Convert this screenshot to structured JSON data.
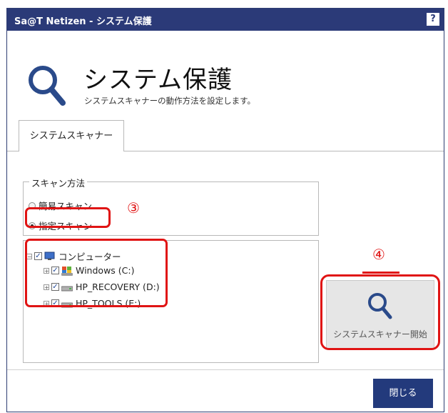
{
  "window": {
    "title": "Sa@T Netizen - システム保護",
    "help_label": "?"
  },
  "header": {
    "title": "システム保護",
    "subtitle": "システムスキャナーの動作方法を設定します。"
  },
  "tabs": [
    {
      "label": "システムスキャナー",
      "selected": true
    }
  ],
  "scan_method": {
    "legend": "スキャン方法",
    "options": [
      {
        "label": "簡易スキャン",
        "selected": false
      },
      {
        "label": "指定スキャン",
        "selected": true
      }
    ]
  },
  "drive_tree": {
    "root": {
      "label": "コンピューター",
      "checked": true,
      "expander": "−"
    },
    "children": [
      {
        "label": "Windows (C:)",
        "checked": true,
        "expander": "+",
        "icon": "windows-drive-icon"
      },
      {
        "label": "HP_RECOVERY (D:)",
        "checked": true,
        "expander": "+",
        "icon": "hard-drive-icon"
      },
      {
        "label": "HP_TOOLS (E:)",
        "checked": true,
        "expander": "+",
        "icon": "hard-drive-icon"
      }
    ]
  },
  "scan_button": {
    "label": "システムスキャナー開始",
    "icon": "search-icon"
  },
  "close_button": {
    "label": "閉じる"
  },
  "annotations": {
    "step3": "③",
    "step4": "④"
  },
  "colors": {
    "title_bar": "#2b3a78",
    "accent": "#233a7c",
    "search_icon": "#2a4a8a",
    "annotation": "#e01414"
  }
}
